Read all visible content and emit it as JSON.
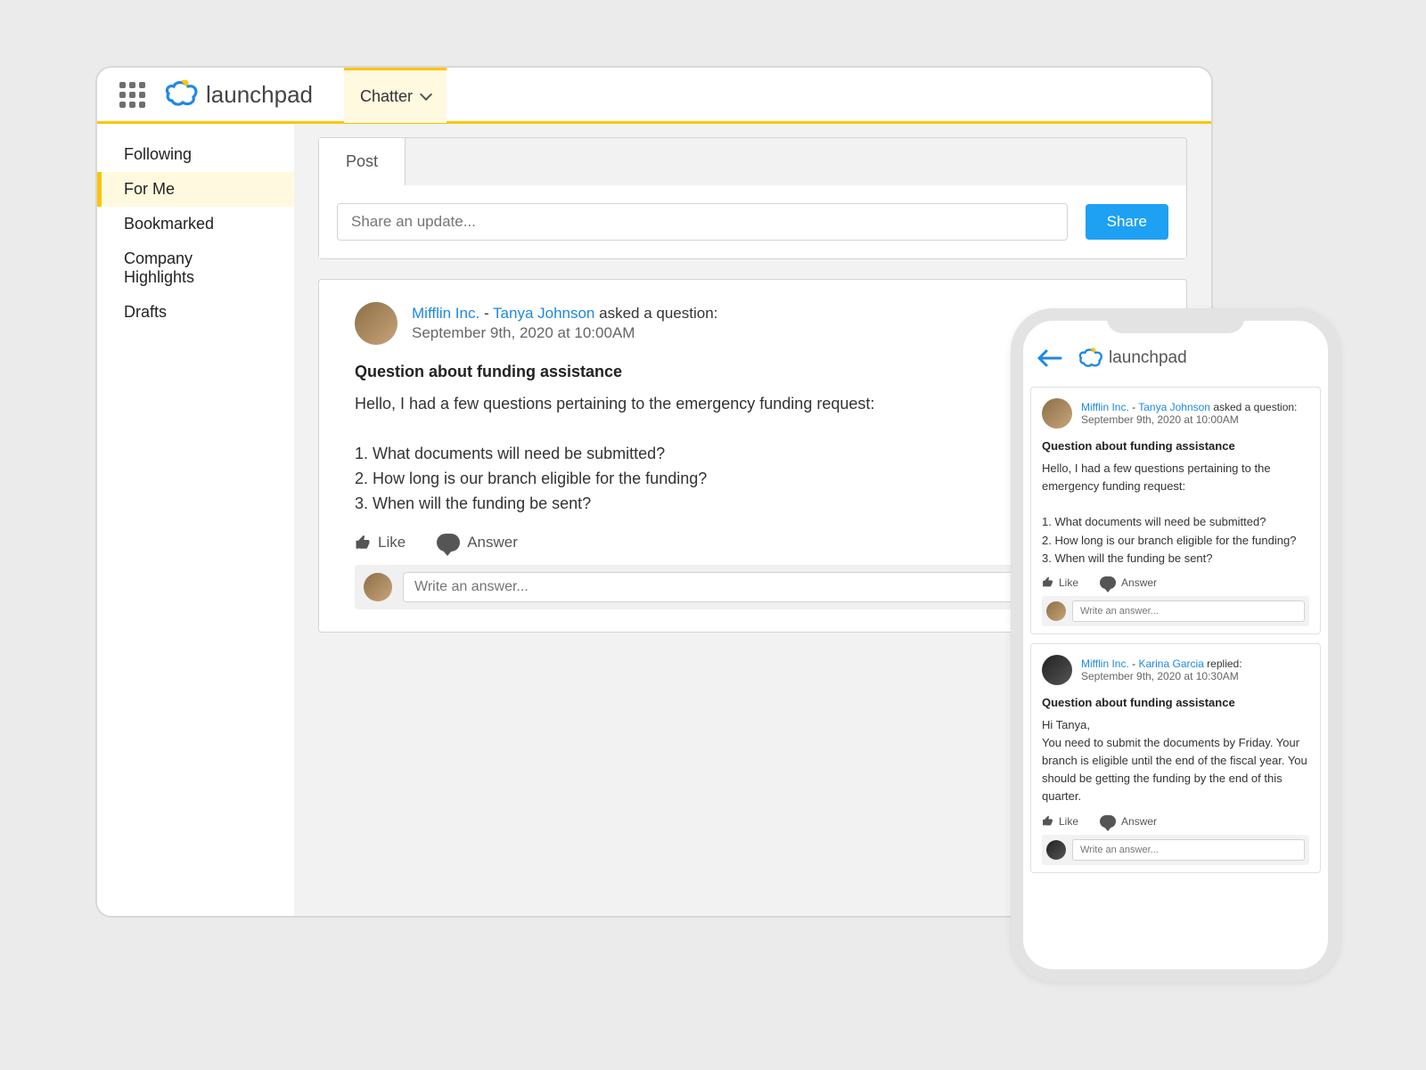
{
  "brand": {
    "name": "launchpad"
  },
  "nav": {
    "tab": "Chatter"
  },
  "sidebar": {
    "items": [
      {
        "label": "Following"
      },
      {
        "label": "For Me"
      },
      {
        "label": "Bookmarked"
      },
      {
        "label": "Company Highlights"
      },
      {
        "label": "Drafts"
      }
    ]
  },
  "composer": {
    "tab_label": "Post",
    "placeholder": "Share an update...",
    "share_label": "Share"
  },
  "feed": {
    "post": {
      "entity": "Mifflin Inc.",
      "sep": " - ",
      "author": "Tanya Johnson",
      "suffix": " asked a question:",
      "timestamp": "September 9th, 2020 at 10:00AM",
      "title": "Question about funding assistance",
      "body": "Hello, I had a few questions pertaining to the emergency funding request:\n\n1. What documents will need be submitted?\n2. How long is our branch eligible for the funding?\n3. When will the funding be sent?",
      "like_label": "Like",
      "answer_label": "Answer",
      "answer_placeholder": "Write an answer..."
    }
  },
  "mobile": {
    "card1": {
      "entity": "Mifflin Inc.",
      "sep": " - ",
      "author": "Tanya Johnson",
      "suffix": " asked a question:",
      "timestamp": "September 9th, 2020 at 10:00AM",
      "title": "Question about funding assistance",
      "body": "Hello, I had a few questions pertaining to the emergency funding request:\n\n1. What documents will need be submitted?\n2. How long is our branch eligible for the funding?\n3. When will the funding be sent?",
      "like_label": "Like",
      "answer_label": "Answer",
      "answer_placeholder": "Write an answer..."
    },
    "card2": {
      "entity": "Mifflin Inc.",
      "sep": " - ",
      "author": "Karina Garcia",
      "suffix": " replied:",
      "timestamp": "September 9th, 2020 at 10:30AM",
      "title": "Question about funding assistance",
      "body": "Hi Tanya,\nYou need to submit the documents by Friday. Your branch is eligible until the end of the fiscal year. You should be getting the funding by the end of this quarter.",
      "like_label": "Like",
      "answer_label": "Answer",
      "answer_placeholder": "Write an answer..."
    }
  }
}
